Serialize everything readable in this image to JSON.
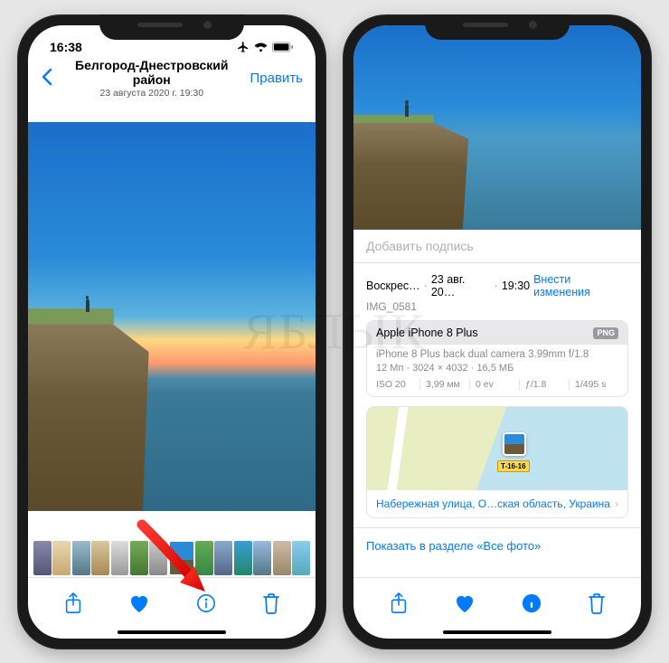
{
  "status": {
    "time": "16:38"
  },
  "nav": {
    "location": "Белгород-Днестровский район",
    "datetime": "23 августа 2020 г.  19:30",
    "edit_label": "Править"
  },
  "caption_placeholder": "Добавить подпись",
  "meta": {
    "weekday": "Воскрес…",
    "date_short": "23 авг. 20…",
    "time": "19:30",
    "adjust_link": "Внести изменения",
    "filename": "IMG_0581"
  },
  "exif": {
    "device": "Apple iPhone 8 Plus",
    "format_badge": "PNG",
    "camera_line": "iPhone 8 Plus back dual camera 3.99mm f/1.8",
    "res_line": "12 Мп · 3024 × 4032 · 16,5 МБ",
    "iso": "ISO 20",
    "focal": "3,99 мм",
    "ev": "0 ev",
    "aperture": "ƒ/1.8",
    "shutter": "1/495 s"
  },
  "map": {
    "road_label": "T-16-16",
    "address": "Набережная улица, О…ская область, Украина"
  },
  "show_all_label": "Показать в разделе «Все фото»",
  "watermark": "ЯБЛЫК"
}
